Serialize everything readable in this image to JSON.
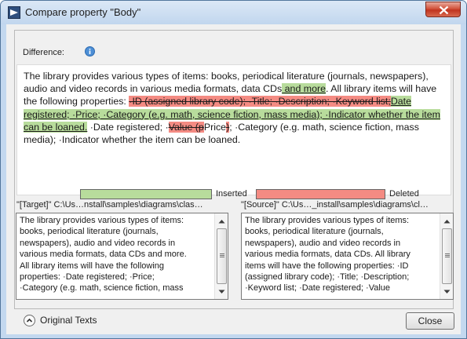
{
  "window": {
    "title": "Compare property \"Body\""
  },
  "difference": {
    "label": "Difference:",
    "segments": [
      {
        "type": "normal",
        "text": "The library provides various types of items: books, periodical literature (journals, newspapers), audio and video records in various media formats, data CDs"
      },
      {
        "type": "ins",
        "text": " and more"
      },
      {
        "type": "normal",
        "text": ". All library items will have the following properties: "
      },
      {
        "type": "del",
        "text": "·ID (assigned library code); ·Title; ·Description; ·Keyword list;"
      },
      {
        "type": "ins",
        "text": "Date registered; ·Price; ·Category (e.g. math, science fiction, mass media); ·Indicator whether the item can be loaned."
      },
      {
        "type": "normal",
        "text": " ·Date registered; ·"
      },
      {
        "type": "del",
        "text": "Value (p"
      },
      {
        "type": "normal",
        "text": "Price"
      },
      {
        "type": "del",
        "text": ")"
      },
      {
        "type": "normal",
        "text": "; ·Category (e.g. math, science fiction, mass media); ·Indicator whether the item can be loaned."
      }
    ]
  },
  "legend": {
    "inserted_label": "Inserted",
    "deleted_label": "Deleted",
    "inserted_color": "#b8dc9c",
    "deleted_color": "#f48b83"
  },
  "target": {
    "header": "\"[Target]\" C:\\Us…nstall\\samples\\diagrams\\clas…",
    "lines": [
      "The library provides various types of items:",
      "books, periodical literature (journals,",
      "newspapers), audio and video records in",
      "various media formats, data CDs and more.",
      "All library items will have the following",
      "properties: ·Date registered; ·Price;",
      "·Category (e.g. math, science fiction, mass"
    ]
  },
  "source": {
    "header": "\"[Source]\" C:\\Us…_install\\samples\\diagrams\\cl…",
    "lines": [
      "The library provides various types of items:",
      "books, periodical literature (journals,",
      "newspapers), audio and video records in",
      "various media formats, data CDs. All library",
      "items will have the following properties: ·ID",
      "(assigned library code); ·Title; ·Description;",
      "·Keyword list; ·Date registered; ·Value"
    ]
  },
  "footer": {
    "original_texts_label": "Original Texts",
    "close_label": "Close"
  }
}
